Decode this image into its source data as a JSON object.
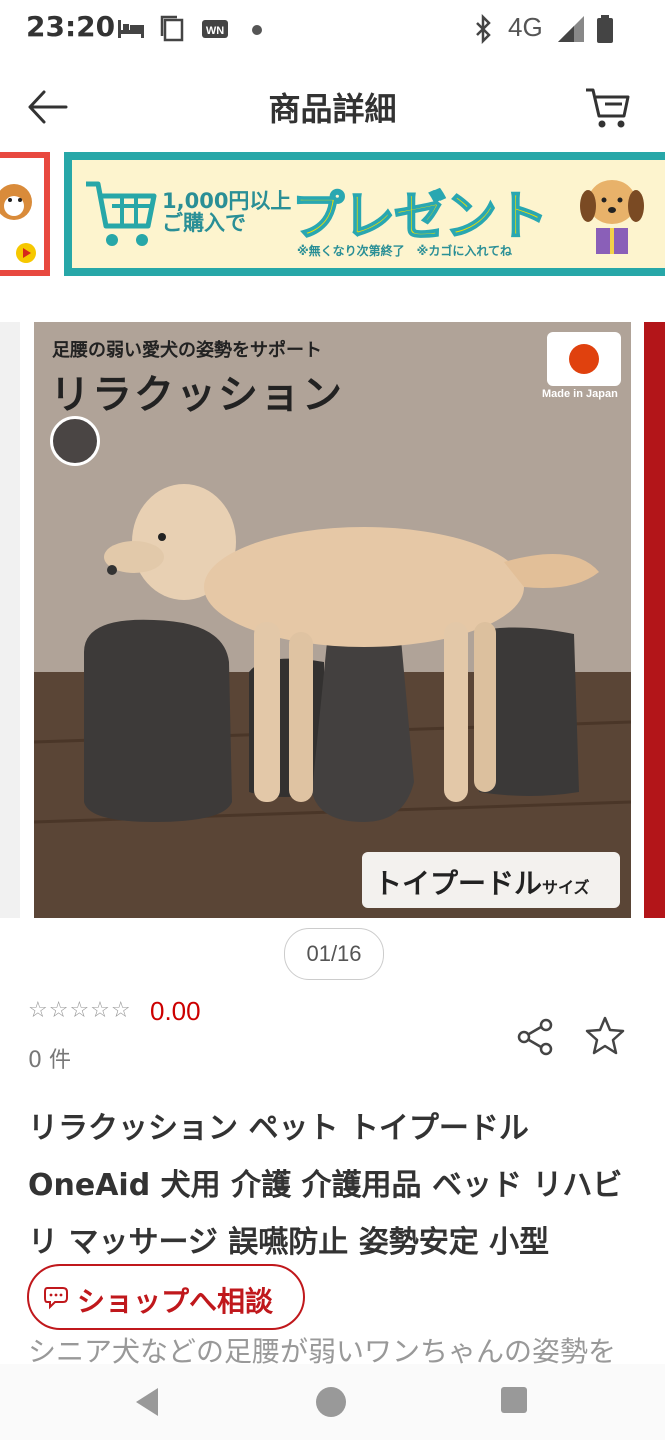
{
  "status_bar": {
    "time": "23:20",
    "network": "4G",
    "icons": [
      "bed-icon",
      "copy-icon",
      "wn-icon",
      "dot-icon",
      "bluetooth-icon",
      "signal-icon",
      "battery-icon"
    ]
  },
  "header": {
    "title": "商品詳細",
    "back_icon": "arrow-left-icon",
    "cart_icon": "cart-icon"
  },
  "promo_banner": {
    "line1": "1,000円以上",
    "line2": "ご購入で",
    "headline": "プレゼント",
    "note": "※無くなり次第終了　※カゴに入れてね"
  },
  "product_image": {
    "subtitle": "足腰の弱い愛犬の姿勢をサポート",
    "title": "リラクッション",
    "made_in": "Made in Japan",
    "size_badge_main": "トイプードル",
    "size_badge_suffix": "サイズ"
  },
  "pager": {
    "text": "01/16"
  },
  "rating": {
    "value": "0.00",
    "stars_filled": 0,
    "stars_total": 5,
    "review_count": "0 件"
  },
  "product": {
    "name": "リラクッション ペット トイプードル OneAid 犬用 介護 介護用品 ベッド リハビリ マッサージ 誤嚥防止 姿勢安定 小型",
    "description_preview": "シニア犬などの足腰が弱いワンちゃんの姿勢を"
  },
  "consult_button": {
    "label": "ショップへ相談"
  },
  "colors": {
    "accent_red": "#c0181c",
    "promo_teal": "#27a7a8",
    "promo_yellow": "#f3e000"
  }
}
